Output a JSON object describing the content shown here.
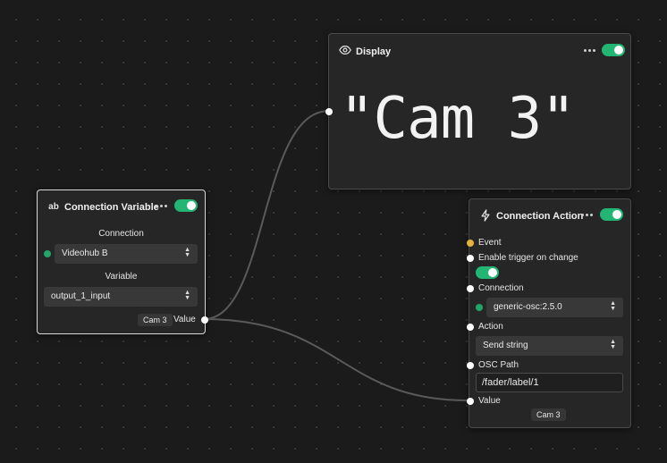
{
  "display_node": {
    "title": "Display",
    "icon": "eye-icon",
    "enabled": true,
    "value": "\"Cam 3\""
  },
  "connection_variable_node": {
    "title": "Connection Variable",
    "icon": "text-ab-icon",
    "enabled": true,
    "connection_label": "Connection",
    "connection_value": "Videohub B",
    "variable_label": "Variable",
    "variable_value": "output_1_input",
    "output_preview": "Cam 3",
    "output_label": "Value"
  },
  "connection_action_node": {
    "title": "Connection Action",
    "icon": "lightning-icon",
    "enabled": true,
    "event_label": "Event",
    "trigger_label": "Enable trigger on change",
    "trigger_enabled": true,
    "connection_label": "Connection",
    "connection_value": "generic-osc:2.5.0",
    "action_label": "Action",
    "action_value": "Send string",
    "osc_path_label": "OSC Path",
    "osc_path_value": "/fader/label/1",
    "value_label": "Value",
    "value_preview": "Cam 3"
  },
  "colors": {
    "toggle_on": "#22b573",
    "status_connected": "#22a56b",
    "event_port": "#e3b341",
    "canvas": "#1b1b1b"
  }
}
